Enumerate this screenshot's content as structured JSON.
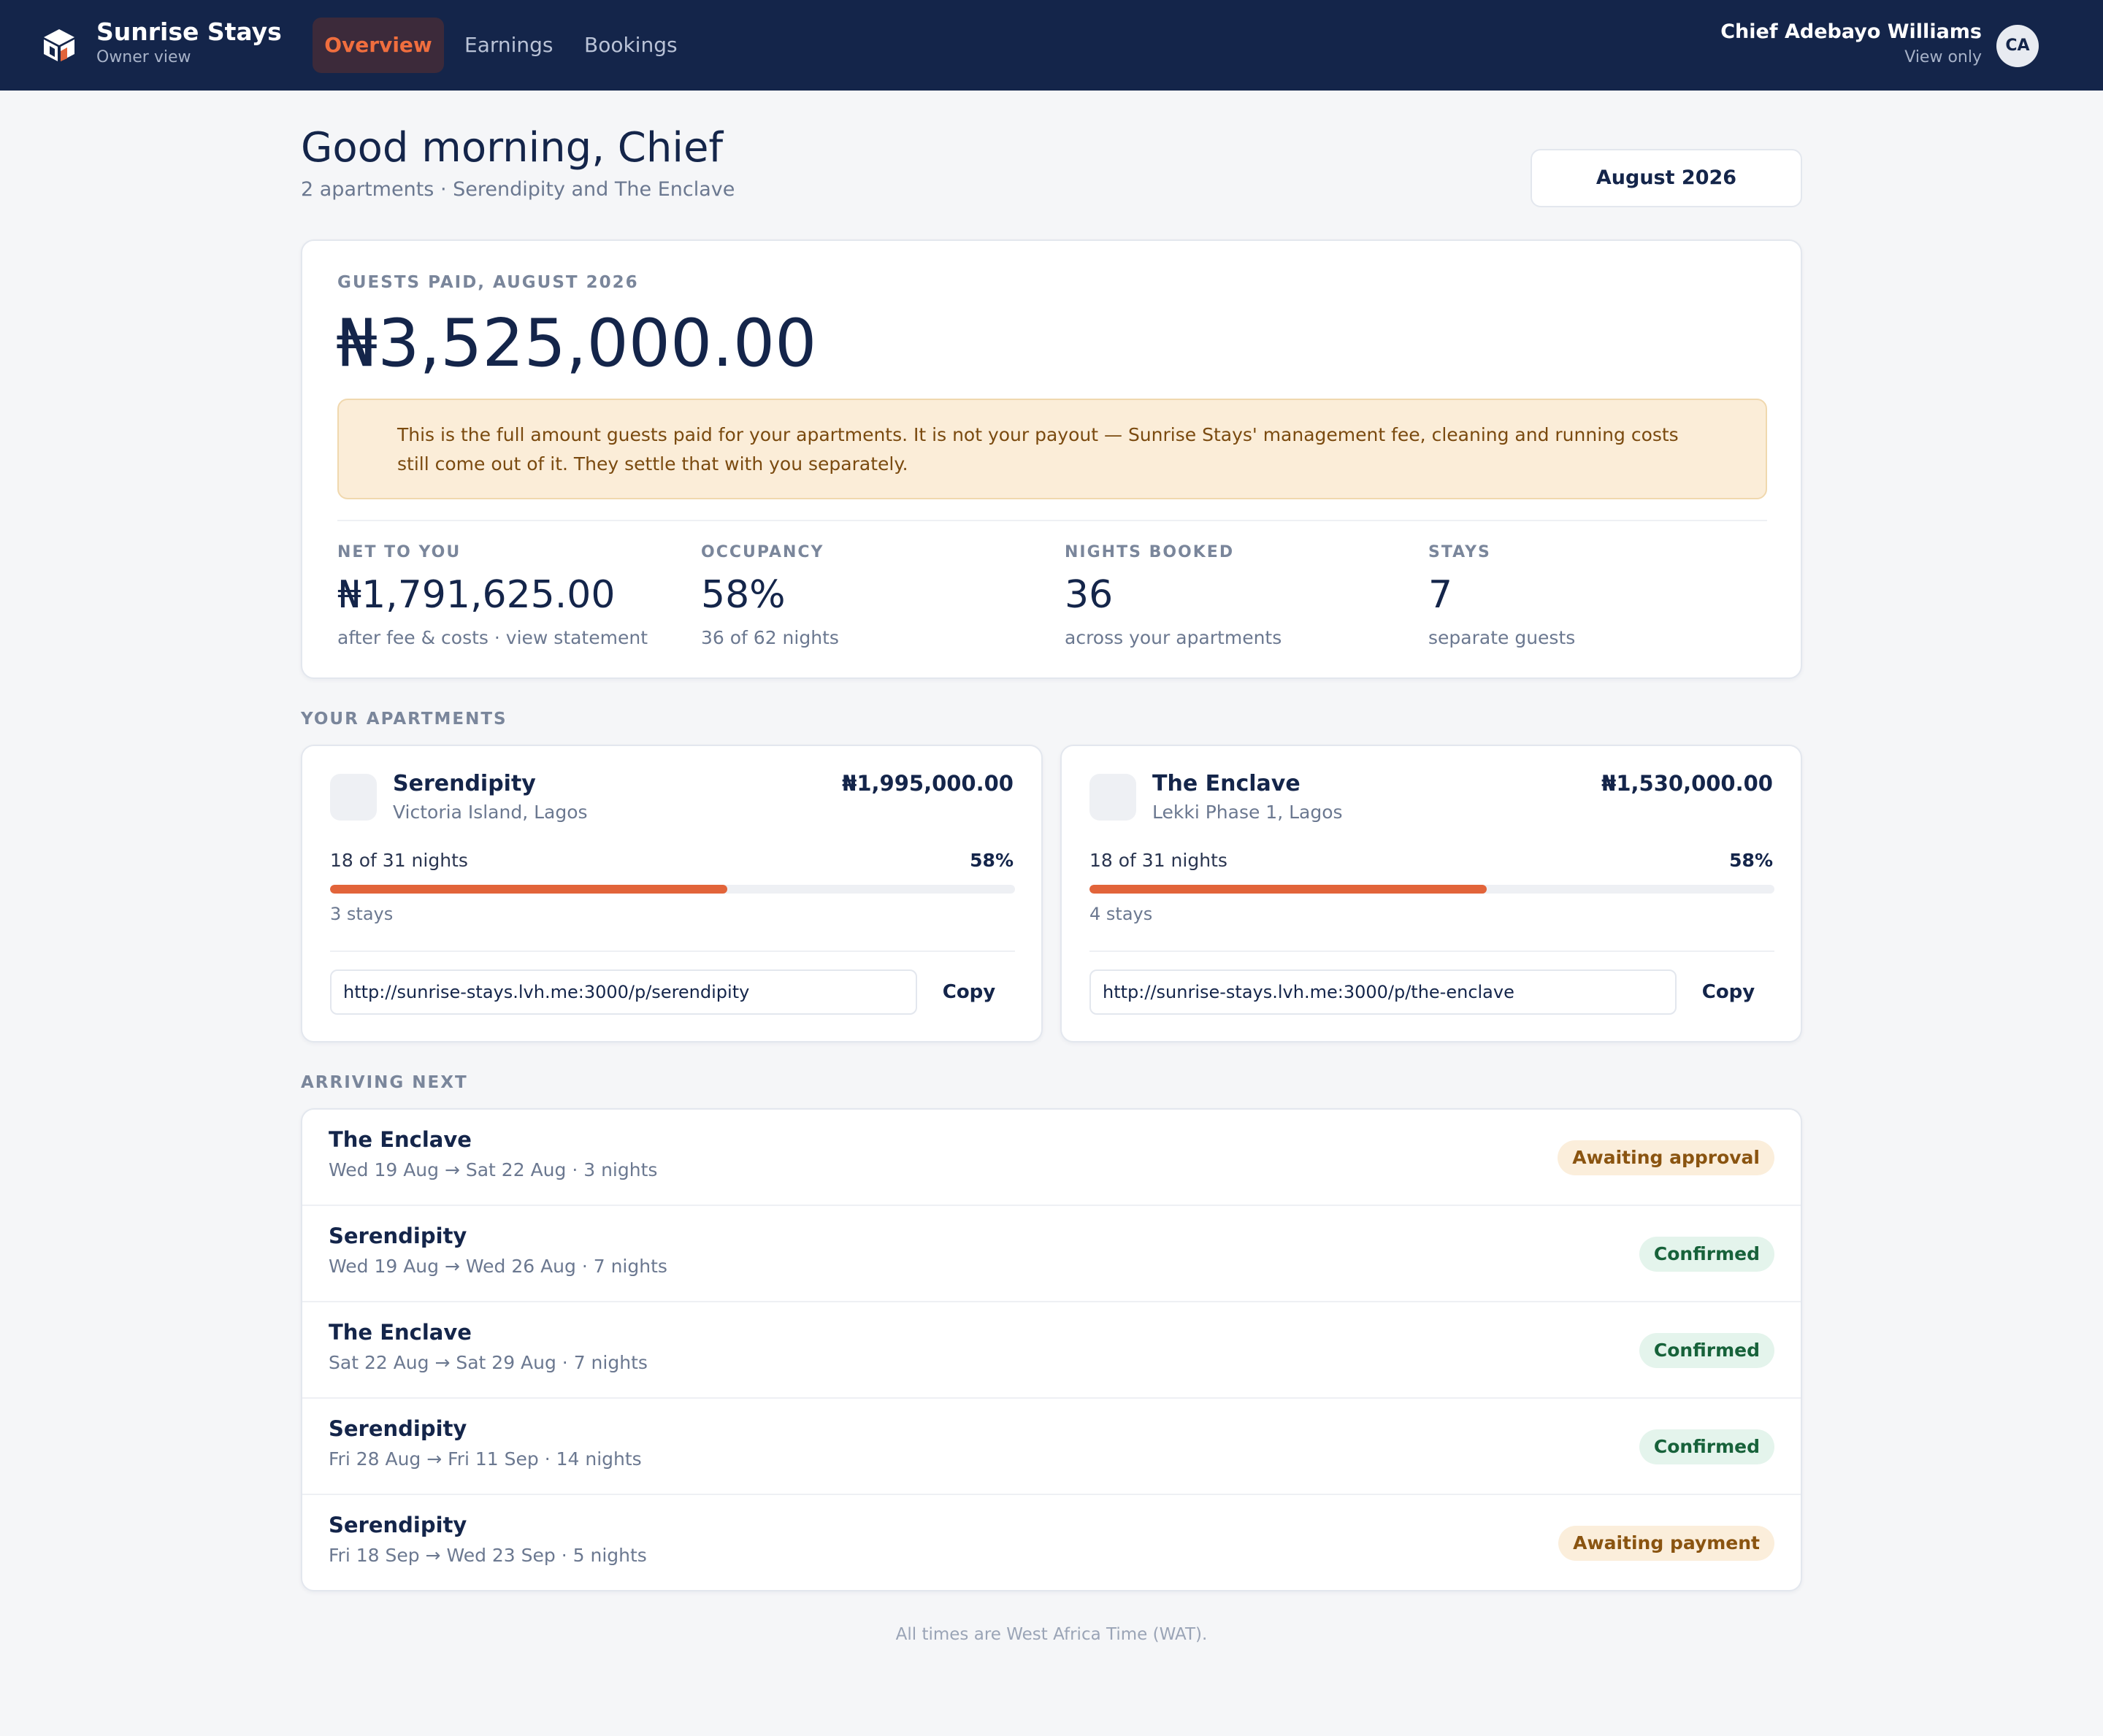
{
  "brand": {
    "name": "Sunrise Stays",
    "subtitle": "Owner view",
    "logo_icon": "house-cube-icon"
  },
  "nav": {
    "items": [
      "Overview",
      "Earnings",
      "Bookings"
    ],
    "active": "Overview"
  },
  "user": {
    "name": "Chief Adebayo Williams",
    "role": "View only",
    "initials": "CA"
  },
  "header": {
    "greeting": "Good morning, Chief",
    "subtitle": "2 apartments · Serendipity and The Enclave",
    "month": "August 2026"
  },
  "summary": {
    "label": "GUESTS PAID, AUGUST 2026",
    "amount": "₦3,525,000.00",
    "notice": "This is the full amount guests paid for your apartments. It is not your payout — Sunrise Stays' management fee, cleaning and running costs still come out of it. They settle that with you separately.",
    "stats": [
      {
        "label": "NET TO YOU",
        "value": "₦1,791,625.00",
        "sub": "after fee & costs · view statement"
      },
      {
        "label": "OCCUPANCY",
        "value": "58%",
        "sub": "36 of 62 nights"
      },
      {
        "label": "NIGHTS BOOKED",
        "value": "36",
        "sub": "across your apartments"
      },
      {
        "label": "STAYS",
        "value": "7",
        "sub": "separate guests"
      }
    ]
  },
  "apartments_section": {
    "label": "YOUR APARTMENTS",
    "apartments": [
      {
        "name": "Serendipity",
        "location": "Victoria Island, Lagos",
        "amount": "₦1,995,000.00",
        "nights": "18 of 31 nights",
        "occupancy": "58%",
        "occupancy_value": 0.58,
        "stays": "3 stays",
        "link": "http://sunrise-stays.lvh.me:3000/p/serendipity",
        "copy_label": "Copy"
      },
      {
        "name": "The Enclave",
        "location": "Lekki Phase 1, Lagos",
        "amount": "₦1,530,000.00",
        "nights": "18 of 31 nights",
        "occupancy": "58%",
        "occupancy_value": 0.58,
        "stays": "4 stays",
        "link": "http://sunrise-stays.lvh.me:3000/p/the-enclave",
        "copy_label": "Copy"
      }
    ]
  },
  "arrivals_section": {
    "label": "ARRIVING NEXT",
    "items": [
      {
        "name": "The Enclave",
        "dates": "Wed 19 Aug → Sat 22 Aug · 3 nights",
        "status": "Awaiting approval",
        "status_kind": "warn"
      },
      {
        "name": "Serendipity",
        "dates": "Wed 19 Aug → Wed 26 Aug · 7 nights",
        "status": "Confirmed",
        "status_kind": "ok"
      },
      {
        "name": "The Enclave",
        "dates": "Sat 22 Aug → Sat 29 Aug · 7 nights",
        "status": "Confirmed",
        "status_kind": "ok"
      },
      {
        "name": "Serendipity",
        "dates": "Fri 28 Aug → Fri 11 Sep · 14 nights",
        "status": "Confirmed",
        "status_kind": "ok"
      },
      {
        "name": "Serendipity",
        "dates": "Fri 18 Sep → Wed 23 Sep · 5 nights",
        "status": "Awaiting payment",
        "status_kind": "warn"
      }
    ]
  },
  "footer": {
    "note": "All times are West Africa Time (WAT)."
  },
  "colors": {
    "navy": "#14254a",
    "accent": "#e2643a",
    "warn_bg": "#fbeedb",
    "ok_bg": "#e4f4ec"
  }
}
